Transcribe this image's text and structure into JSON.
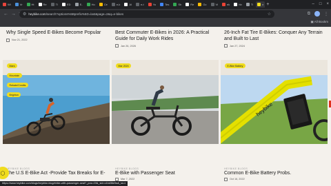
{
  "tabs": [
    {
      "label": "Wi",
      "color": "#e8453c"
    },
    {
      "label": "Vr",
      "color": "#4a90d9"
    },
    {
      "label": "Ht",
      "color": "#34a853"
    },
    {
      "label": "Re",
      "color": "#ffffff"
    },
    {
      "label": "Tl",
      "color": "#5f6368"
    },
    {
      "label": "ED",
      "color": "#ffffff"
    },
    {
      "label": "E-",
      "color": "#9aa0a6"
    },
    {
      "label": "Ho",
      "color": "#34a853"
    },
    {
      "label": "Ce",
      "color": "#fbbc04"
    },
    {
      "label": "e-k",
      "color": "#5f6368"
    },
    {
      "label": "Al",
      "color": "#ffffff"
    },
    {
      "label": "e-t",
      "color": "#5f6368"
    },
    {
      "label": "Yo",
      "color": "#ea4335"
    },
    {
      "label": "Tes",
      "color": "#4285f4"
    },
    {
      "label": "Sh",
      "color": "#34a853"
    },
    {
      "label": "Re",
      "color": "#ffffff"
    },
    {
      "label": "Gc",
      "color": "#fbbc04"
    },
    {
      "label": "Vi",
      "color": "#5f6368"
    },
    {
      "label": "ek",
      "color": "#ea4335"
    },
    {
      "label": "hb",
      "color": "#ffffff"
    },
    {
      "label": "Tl",
      "color": "#9aa0a6"
    }
  ],
  "active_tab": {
    "label": "",
    "close": "×"
  },
  "new_tab": "+",
  "url": {
    "host": "heybike.com",
    "rest": "/search?options%5Bprefix%5D=last&page=2&q=e-bikes"
  },
  "bookmarks": {
    "all": "All Bookm"
  },
  "top_posts": [
    {
      "title": "Why Single Speed E-Bikes Become Popular",
      "date": "Nov 21, 2022"
    },
    {
      "title": "Best Commuter E-Bikes in 2026: A Practical Guide for Daily Work Rides",
      "date": "Jan 26, 2026"
    },
    {
      "title": "26-Inch Fat Tire E-Bikes: Conquer Any Terrain and Built to Last",
      "date": "Jan 27, 2024"
    }
  ],
  "card1_tags": [
    "Mars",
    "Mountain",
    "Rebate/Credits",
    "Brighton"
  ],
  "card2_tags": [
    "Mar 2024"
  ],
  "card3_tags": [
    "E-Bike Battery"
  ],
  "bottom_posts": [
    {
      "category": "HEYBIKE BLOGS",
      "title": "The U.S E-Bike Act -Provide Tax Breaks for E-"
    },
    {
      "category": "HEYBIKE BLOGS",
      "title": "E-Bike with Passenger Seat",
      "date": "Mar 7, 2022"
    },
    {
      "category": "HEYBIKE BLOGS",
      "title": "Common E-Bike Battery Probs.",
      "date": "Oct 16, 2022"
    }
  ],
  "card3_brand": "heybike",
  "status_url": "https://www.heybike.com/blogs/heybike-blog/ebike-with-passenger-seat?_pos=23&_sid=c1bd36e9a&_ss=r",
  "icons": [
    "back-icon",
    "forward-icon",
    "reload-icon",
    "tune-icon",
    "star-icon",
    "extensions-icon",
    "chat-icon"
  ]
}
